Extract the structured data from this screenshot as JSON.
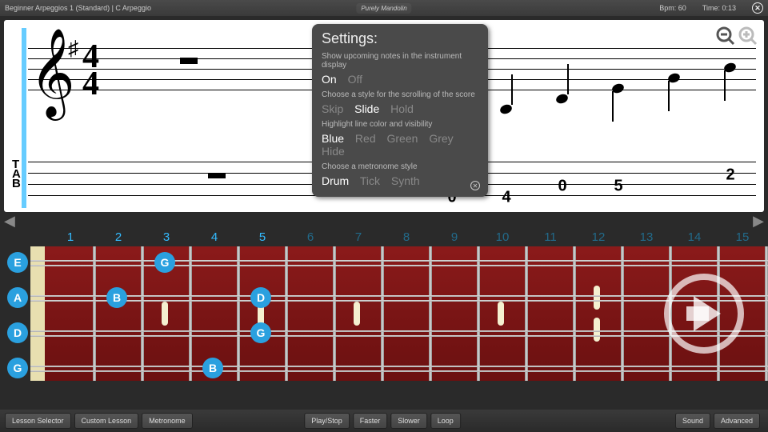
{
  "header": {
    "lesson_title": "Beginner Arpeggios 1 (Standard)  |  C Arpeggio",
    "app_name": "Purely Mandolin",
    "bpm_label": "Bpm: 60",
    "time_label": "Time: 0:13"
  },
  "settings": {
    "title": "Settings:",
    "upcoming_desc": "Show upcoming notes in the instrument display",
    "upcoming_opts": [
      "On",
      "Off"
    ],
    "upcoming_sel": "On",
    "scroll_desc": "Choose a style for the scrolling of the score",
    "scroll_opts": [
      "Skip",
      "Slide",
      "Hold"
    ],
    "scroll_sel": "Slide",
    "highlight_desc": "Highlight line color and visibility",
    "highlight_opts": [
      "Blue",
      "Red",
      "Green",
      "Grey",
      "Hide"
    ],
    "highlight_sel": "Blue",
    "metronome_desc": "Choose a metronome style",
    "metronome_opts": [
      "Drum",
      "Tick",
      "Synth"
    ],
    "metronome_sel": "Drum"
  },
  "score": {
    "key_sig": "♯",
    "time_top": "4",
    "time_bot": "4",
    "tab_values": [
      "0",
      "4",
      "0",
      "5",
      "2"
    ]
  },
  "fretboard": {
    "open_strings": [
      "E",
      "A",
      "D",
      "G"
    ],
    "fret_numbers": [
      "1",
      "2",
      "3",
      "4",
      "5",
      "6",
      "7",
      "8",
      "9",
      "10",
      "11",
      "12",
      "13",
      "14",
      "15"
    ],
    "highlighted_frets": [
      "1",
      "2",
      "3",
      "4",
      "5"
    ],
    "marked_notes": [
      {
        "string": 0,
        "fret": 3,
        "label": "G"
      },
      {
        "string": 1,
        "fret": 2,
        "label": "B"
      },
      {
        "string": 1,
        "fret": 5,
        "label": "D"
      },
      {
        "string": 2,
        "fret": 5,
        "label": "G"
      },
      {
        "string": 3,
        "fret": 4,
        "label": "B"
      }
    ]
  },
  "buttons": {
    "lesson_selector": "Lesson Selector",
    "custom_lesson": "Custom Lesson",
    "metronome": "Metronome",
    "play_stop": "Play/Stop",
    "faster": "Faster",
    "slower": "Slower",
    "loop": "Loop",
    "sound": "Sound",
    "advanced": "Advanced"
  }
}
